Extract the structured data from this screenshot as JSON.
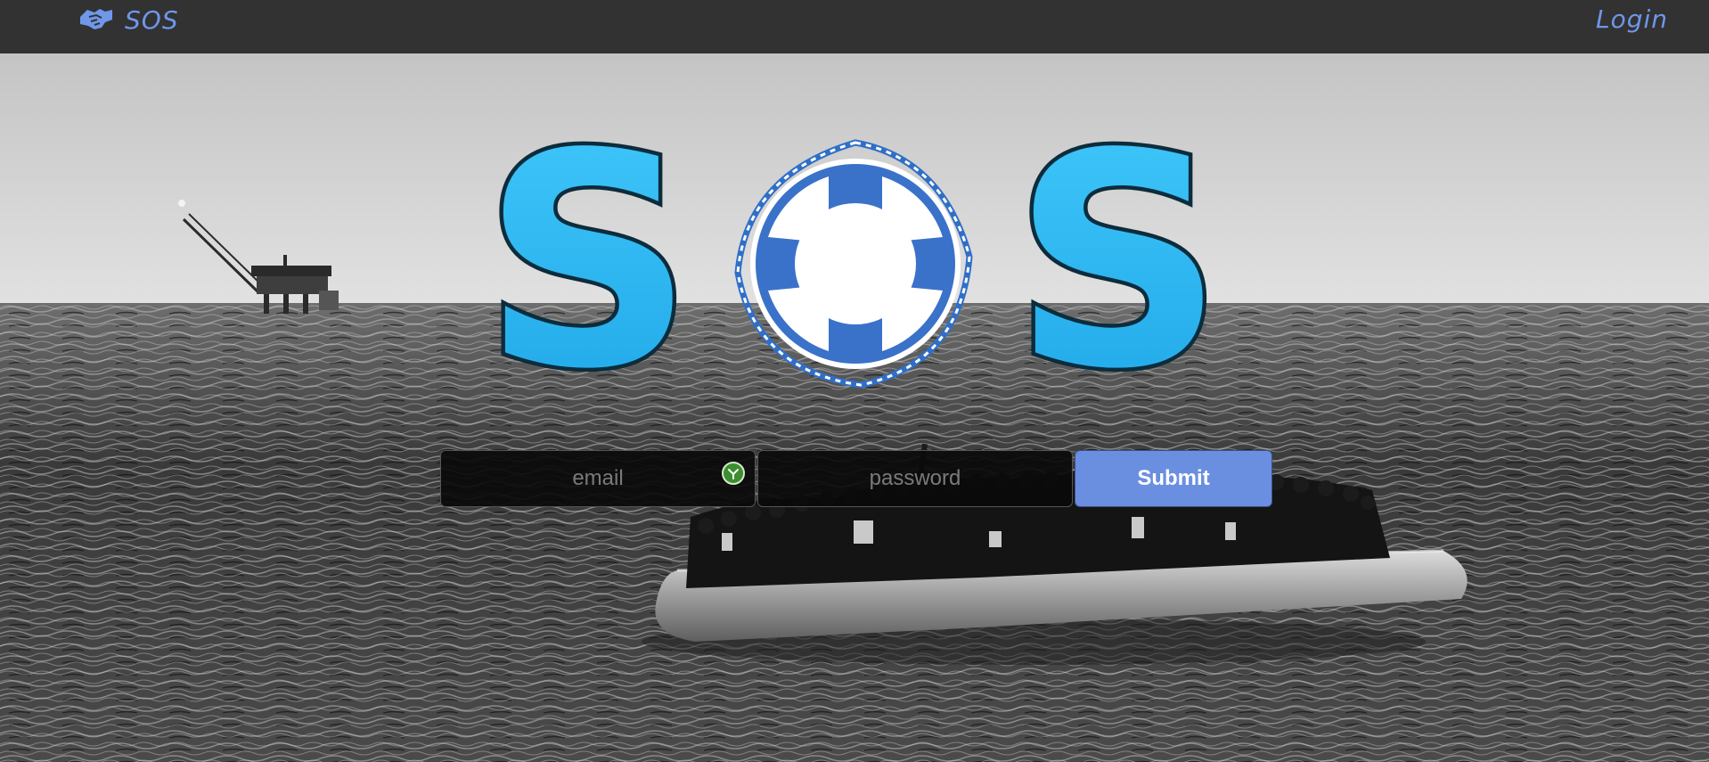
{
  "navbar": {
    "brand_label": "SOS",
    "brand_icon": "handshake-icon",
    "login_label": "Login",
    "link_color": "#6f97ea",
    "background": "#323232"
  },
  "hero": {
    "logo_letters": [
      "S",
      "S"
    ],
    "logo_center_icon": "life-ring-icon",
    "logo_letter_color": "#29b8f2",
    "ring_color": "#3a72c9"
  },
  "login_form": {
    "email_placeholder": "email",
    "password_placeholder": "password",
    "submit_label": "Submit",
    "submit_color": "#6b8fe0",
    "password_manager_icon": "password-manager-icon"
  }
}
